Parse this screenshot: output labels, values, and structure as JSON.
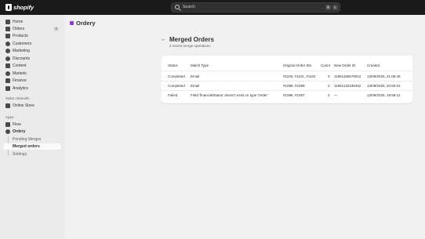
{
  "topbar": {
    "logo_text": "shopify",
    "search_label": "Search",
    "shortcut_key_1": "⌘",
    "shortcut_key_2": "K"
  },
  "sidebar": {
    "items": [
      {
        "label": "Home"
      },
      {
        "label": "Orders",
        "badge": "6"
      },
      {
        "label": "Products"
      },
      {
        "label": "Customers"
      },
      {
        "label": "Marketing"
      },
      {
        "label": "Discounts"
      },
      {
        "label": "Content"
      },
      {
        "label": "Markets"
      },
      {
        "label": "Finance"
      },
      {
        "label": "Analytics"
      }
    ],
    "sales_channels_label": "Sales channels",
    "online_store_label": "Online Store",
    "apps_label": "Apps",
    "flow_label": "Flow",
    "ordery_label": "Ordery",
    "sub_items": [
      {
        "label": "Pending Merges"
      },
      {
        "label": "Merged orders"
      },
      {
        "label": "Settings"
      }
    ]
  },
  "app_header": {
    "title": "Ordery"
  },
  "page": {
    "back_label": "←",
    "title": "Merged Orders",
    "subtitle": "3 recent merge operations"
  },
  "table": {
    "headers": {
      "status": "Status",
      "match_type": "Match Type",
      "original_ids": "Original Order IDs",
      "count": "Count",
      "new_order_id": "New Order ID",
      "created": "Created"
    },
    "rows": [
      {
        "status": "Completed",
        "match_type": "Email",
        "original_ids": "#1100, #1101, #1102",
        "count": "3",
        "new_order_id": "11861166579012",
        "created": "13/09/2025, 21:05:49"
      },
      {
        "status": "Completed",
        "match_type": "Email",
        "original_ids": "#1098, #1099",
        "count": "2",
        "new_order_id": "11861132335452",
        "created": "13/09/2025, 20:50:02"
      },
      {
        "status": "Failed",
        "match_type": "Field 'financialStatus' doesn't exist on type 'Order'",
        "original_ids": "#1096, #1097",
        "count": "2",
        "new_order_id": "—",
        "created": "13/09/2025, 19:58:12"
      }
    ]
  }
}
